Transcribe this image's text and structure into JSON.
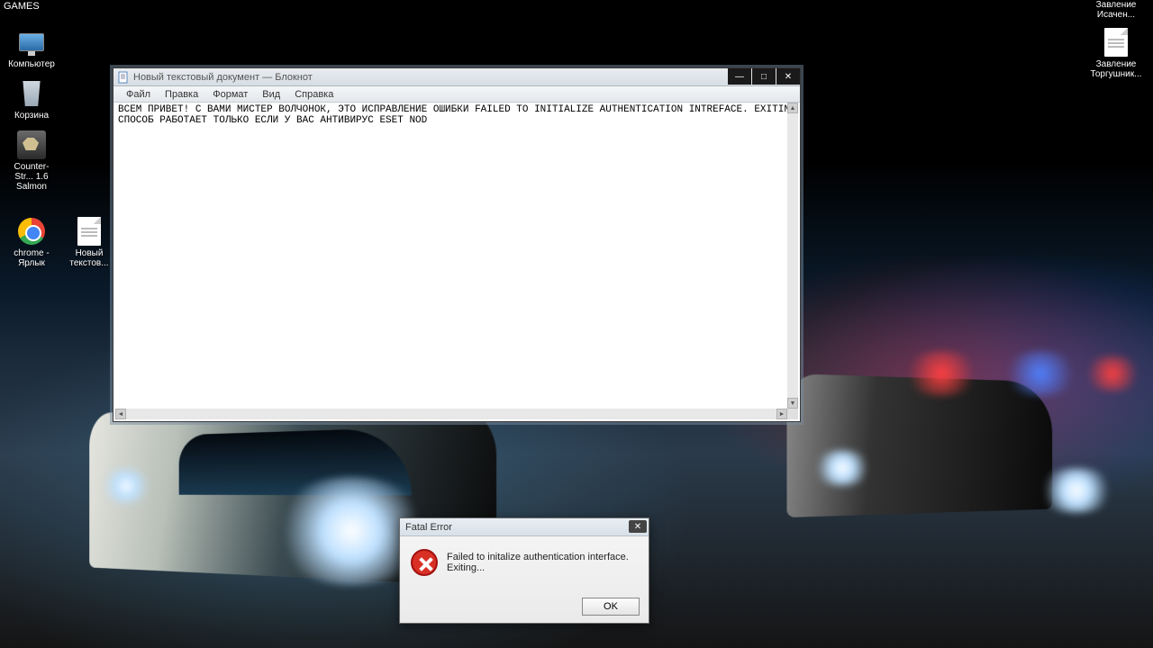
{
  "topbar": {
    "games_label": "GAMES"
  },
  "desktop": {
    "computer": "Компьютер",
    "recycle": "Корзина",
    "cs": "Counter-Str... 1.6 Salmon",
    "chrome": "chrome - Ярлык",
    "newtext": "Новый текстов...",
    "right1": "Завление Исачен...",
    "right2": "Завление Торгушник..."
  },
  "notepad": {
    "title": "Новый текстовый документ — Блокнот",
    "menu": {
      "file": "Файл",
      "edit": "Правка",
      "format": "Формат",
      "view": "Вид",
      "help": "Справка"
    },
    "content": "ВСЕМ ПРИВЕТ! С ВАМИ МИСТЕР ВОЛЧОНОК, ЭТО ИСПРАВЛЕНИЕ ОШИБКИ FAILED TO INITIALIZE AUTHENTICATION INTREFACE. EXITING...\nСПОСОБ РАБОТАЕТ ТОЛЬКО ЕСЛИ У ВАС АНТИВИРУС ESET NOD",
    "btn_min": "—",
    "btn_max": "□",
    "btn_close": "✕"
  },
  "error": {
    "title": "Fatal Error",
    "message": "Failed to initalize authentication interface. Exiting...",
    "ok": "OK",
    "close": "✕"
  }
}
